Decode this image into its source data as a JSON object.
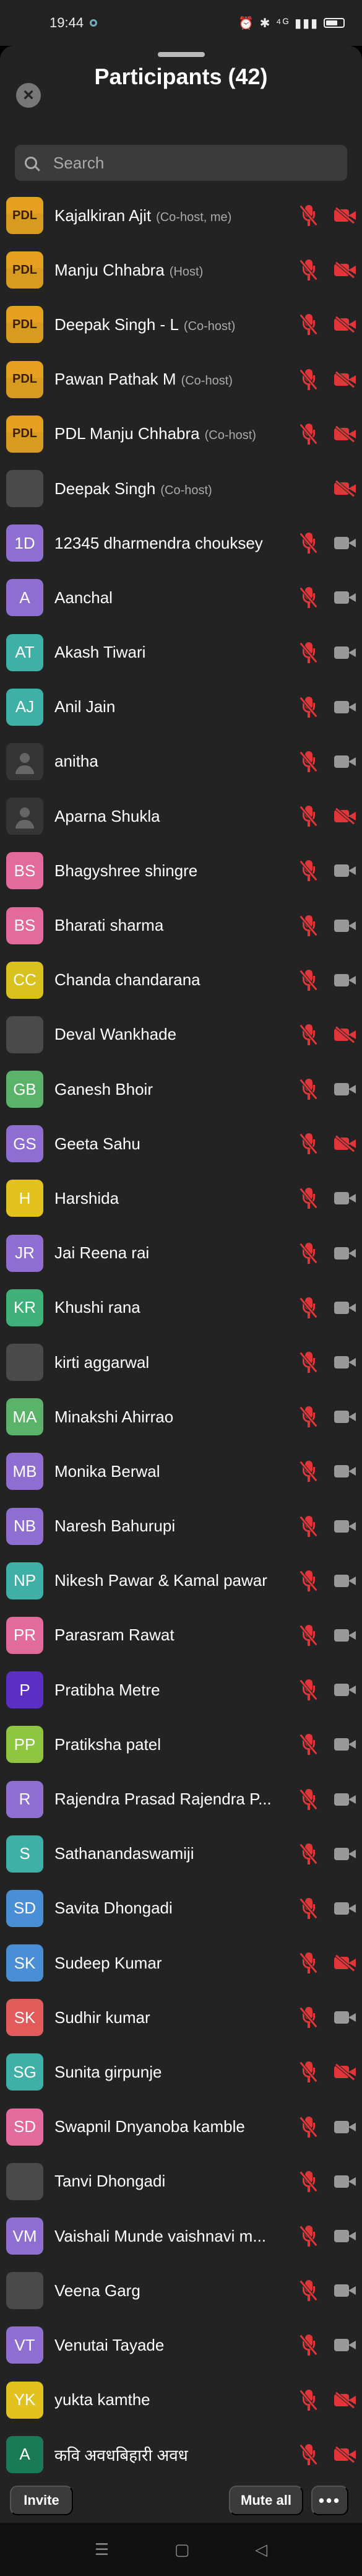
{
  "status_bar": {
    "time": "19:44",
    "system_icons": "⏰ ✱ ⁴ᴳ ▮▮▮"
  },
  "header": {
    "title": "Participants (42)",
    "close_icon": "close-icon"
  },
  "search": {
    "placeholder": "Search"
  },
  "colors": {
    "muted": "#e0363a",
    "camera_on": "#999999",
    "sheet_bg": "#232323"
  },
  "participants": [
    {
      "name": "Kajalkiran Ajit",
      "role": "(Co-host, me)",
      "avatar": "PDL",
      "avatar_type": "pdl",
      "mic": "muted",
      "cam": "off"
    },
    {
      "name": "Manju Chhabra",
      "role": "(Host)",
      "avatar": "PDL",
      "avatar_type": "pdl",
      "mic": "muted",
      "cam": "off"
    },
    {
      "name": "Deepak Singh - L",
      "role": "(Co-host)",
      "avatar": "PDL",
      "avatar_type": "pdl",
      "mic": "muted",
      "cam": "off"
    },
    {
      "name": "Pawan Pathak M",
      "role": "(Co-host)",
      "avatar": "PDL",
      "avatar_type": "pdl",
      "mic": "muted",
      "cam": "off"
    },
    {
      "name": "PDL Manju Chhabra",
      "role": "(Co-host)",
      "avatar": "PDL",
      "avatar_type": "pdl",
      "mic": "muted",
      "cam": "off"
    },
    {
      "name": "Deepak Singh",
      "role": "(Co-host)",
      "avatar": "",
      "avatar_type": "photo",
      "mic": "none",
      "cam": "off"
    },
    {
      "name": "12345 dharmendra chouksey",
      "role": "",
      "avatar": "1D",
      "avatar_type": "initials",
      "color": "#8e6fd1",
      "mic": "muted",
      "cam": "on"
    },
    {
      "name": "Aanchal",
      "role": "",
      "avatar": "A",
      "avatar_type": "initials",
      "color": "#8e6fd1",
      "mic": "muted",
      "cam": "on"
    },
    {
      "name": "Akash Tiwari",
      "role": "",
      "avatar": "AT",
      "avatar_type": "initials",
      "color": "#3fb0a6",
      "mic": "muted",
      "cam": "on"
    },
    {
      "name": "Anil Jain",
      "role": "",
      "avatar": "AJ",
      "avatar_type": "initials",
      "color": "#3fb0a6",
      "mic": "muted",
      "cam": "on"
    },
    {
      "name": "anitha",
      "role": "",
      "avatar": "",
      "avatar_type": "anon",
      "mic": "muted",
      "cam": "on"
    },
    {
      "name": "Aparna Shukla",
      "role": "",
      "avatar": "",
      "avatar_type": "anon",
      "mic": "muted",
      "cam": "off"
    },
    {
      "name": "Bhagyshree shingre",
      "role": "",
      "avatar": "BS",
      "avatar_type": "initials",
      "color": "#e26b9b",
      "mic": "muted",
      "cam": "on"
    },
    {
      "name": "Bharati sharma",
      "role": "",
      "avatar": "BS",
      "avatar_type": "initials",
      "color": "#e26b9b",
      "mic": "muted",
      "cam": "on"
    },
    {
      "name": "Chanda chandarana",
      "role": "",
      "avatar": "CC",
      "avatar_type": "initials",
      "color": "#d9c21f",
      "mic": "muted",
      "cam": "on"
    },
    {
      "name": "Deval Wankhade",
      "role": "",
      "avatar": "",
      "avatar_type": "photo",
      "mic": "muted",
      "cam": "off"
    },
    {
      "name": "Ganesh Bhoir",
      "role": "",
      "avatar": "GB",
      "avatar_type": "initials",
      "color": "#5bb36a",
      "mic": "muted",
      "cam": "on"
    },
    {
      "name": "Geeta Sahu",
      "role": "",
      "avatar": "GS",
      "avatar_type": "initials",
      "color": "#8e6fd1",
      "mic": "muted",
      "cam": "off"
    },
    {
      "name": "Harshida",
      "role": "",
      "avatar": "H",
      "avatar_type": "initials",
      "color": "#e2c21f",
      "mic": "muted",
      "cam": "on"
    },
    {
      "name": "Jai Reena rai",
      "role": "",
      "avatar": "JR",
      "avatar_type": "initials",
      "color": "#8e6fd1",
      "mic": "muted",
      "cam": "on"
    },
    {
      "name": "Khushi rana",
      "role": "",
      "avatar": "KR",
      "avatar_type": "initials",
      "color": "#3fb07a",
      "mic": "muted",
      "cam": "on"
    },
    {
      "name": "kirti aggarwal",
      "role": "",
      "avatar": "",
      "avatar_type": "photo",
      "mic": "muted",
      "cam": "on"
    },
    {
      "name": "Minakshi Ahirrao",
      "role": "",
      "avatar": "MA",
      "avatar_type": "initials",
      "color": "#5bb36a",
      "mic": "muted",
      "cam": "on"
    },
    {
      "name": "Monika Berwal",
      "role": "",
      "avatar": "MB",
      "avatar_type": "initials",
      "color": "#8e6fd1",
      "mic": "muted",
      "cam": "on"
    },
    {
      "name": "Naresh Bahurupi",
      "role": "",
      "avatar": "NB",
      "avatar_type": "initials",
      "color": "#8e6fd1",
      "mic": "muted",
      "cam": "on"
    },
    {
      "name": "Nikesh Pawar & Kamal pawar",
      "role": "",
      "avatar": "NP",
      "avatar_type": "initials",
      "color": "#3fb0a6",
      "mic": "muted",
      "cam": "on"
    },
    {
      "name": "Parasram Rawat",
      "role": "",
      "avatar": "PR",
      "avatar_type": "initials",
      "color": "#e26b9b",
      "mic": "muted",
      "cam": "on"
    },
    {
      "name": "Pratibha Metre",
      "role": "",
      "avatar": "P",
      "avatar_type": "initials",
      "color": "#5b2fc4",
      "mic": "muted",
      "cam": "on"
    },
    {
      "name": "Pratiksha patel",
      "role": "",
      "avatar": "PP",
      "avatar_type": "initials",
      "color": "#8ec63f",
      "mic": "muted",
      "cam": "on"
    },
    {
      "name": "Rajendra  Prasad Rajendra P...",
      "role": "",
      "avatar": "R",
      "avatar_type": "initials",
      "color": "#8e6fd1",
      "mic": "muted",
      "cam": "on"
    },
    {
      "name": "Sathanandaswamiji",
      "role": "",
      "avatar": "S",
      "avatar_type": "initials",
      "color": "#3fb0a6",
      "mic": "muted",
      "cam": "on"
    },
    {
      "name": "Savita Dhongadi",
      "role": "",
      "avatar": "SD",
      "avatar_type": "initials",
      "color": "#4a8fd6",
      "mic": "muted",
      "cam": "on"
    },
    {
      "name": "Sudeep Kumar",
      "role": "",
      "avatar": "SK",
      "avatar_type": "initials",
      "color": "#4a8fd6",
      "mic": "muted",
      "cam": "off"
    },
    {
      "name": "Sudhir kumar",
      "role": "",
      "avatar": "SK",
      "avatar_type": "initials",
      "color": "#e25a5a",
      "mic": "muted",
      "cam": "on"
    },
    {
      "name": "Sunita girpunje",
      "role": "",
      "avatar": "SG",
      "avatar_type": "initials",
      "color": "#3fb0a6",
      "mic": "muted",
      "cam": "off"
    },
    {
      "name": "Swapnil Dnyanoba kamble",
      "role": "",
      "avatar": "SD",
      "avatar_type": "initials",
      "color": "#e26b9b",
      "mic": "muted",
      "cam": "on"
    },
    {
      "name": "Tanvi Dhongadi",
      "role": "",
      "avatar": "",
      "avatar_type": "photo",
      "mic": "muted",
      "cam": "on"
    },
    {
      "name": "Vaishali Munde vaishnavi m...",
      "role": "",
      "avatar": "VM",
      "avatar_type": "initials",
      "color": "#8e6fd1",
      "mic": "muted",
      "cam": "on"
    },
    {
      "name": "Veena Garg",
      "role": "",
      "avatar": "",
      "avatar_type": "photo",
      "mic": "muted",
      "cam": "on"
    },
    {
      "name": "Venutai Tayade",
      "role": "",
      "avatar": "VT",
      "avatar_type": "initials",
      "color": "#8e6fd1",
      "mic": "muted",
      "cam": "on"
    },
    {
      "name": "yukta kamthe",
      "role": "",
      "avatar": "YK",
      "avatar_type": "initials",
      "color": "#e2c21f",
      "mic": "muted",
      "cam": "off"
    },
    {
      "name": "कवि अवधबिहारी अवध",
      "role": "",
      "avatar": "A",
      "avatar_type": "initials",
      "color": "#1a7a55",
      "mic": "muted",
      "cam": "off"
    }
  ],
  "footer": {
    "invite_label": "Invite",
    "mute_all_label": "Mute all",
    "more_label": "•••"
  },
  "nav": {
    "menu": "☰",
    "home": "▢",
    "back": "◁"
  }
}
